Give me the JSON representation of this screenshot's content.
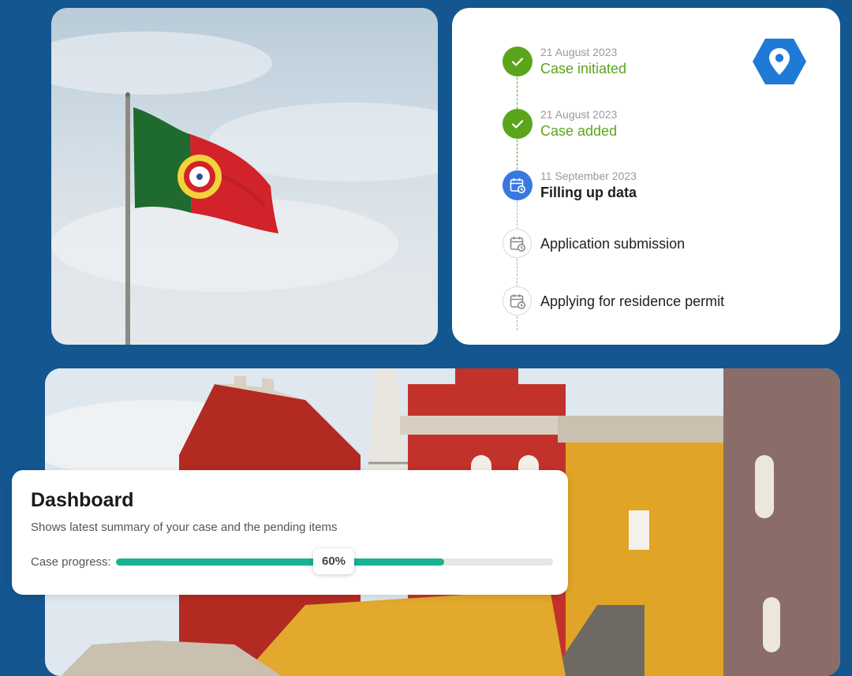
{
  "timeline": {
    "steps": [
      {
        "date": "21 August 2023",
        "label": "Case initiated",
        "status": "done"
      },
      {
        "date": "21 August 2023",
        "label": "Case added",
        "status": "done"
      },
      {
        "date": "11 September 2023",
        "label": "Filling up data",
        "status": "current"
      },
      {
        "label": "Application submission",
        "status": "pending"
      },
      {
        "label": "Applying for residence permit",
        "status": "pending"
      }
    ],
    "badge_icon": "map-pin-icon"
  },
  "dashboard": {
    "title": "Dashboard",
    "subtitle": "Shows latest summary of your case and the pending items",
    "progress_label": "Case progress:",
    "progress_text": "60%",
    "progress_value": 60
  },
  "colors": {
    "background": "#14568f",
    "done": "#5aa51c",
    "current": "#3a78e0",
    "progress": "#19b293",
    "badge": "#1f7ad6"
  }
}
